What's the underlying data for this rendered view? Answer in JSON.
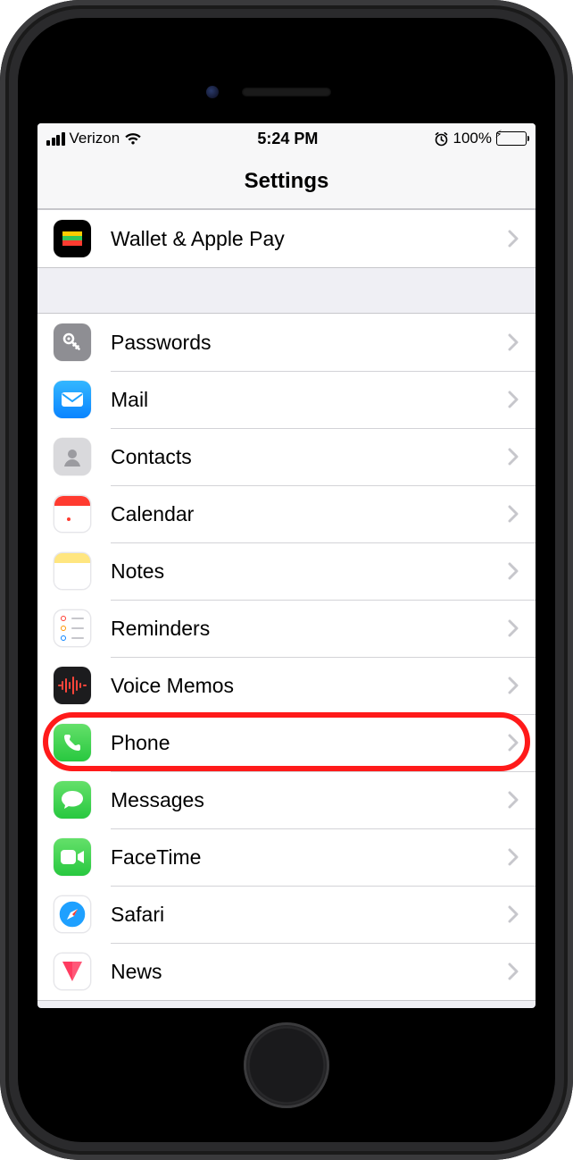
{
  "status_bar": {
    "carrier": "Verizon",
    "time": "5:24 PM",
    "battery_percent": "100%"
  },
  "header": {
    "title": "Settings"
  },
  "sections": [
    {
      "rows": [
        {
          "id": "wallet",
          "label": "Wallet & Apple Pay",
          "icon": "wallet-icon"
        }
      ]
    },
    {
      "rows": [
        {
          "id": "passwords",
          "label": "Passwords",
          "icon": "key-icon"
        },
        {
          "id": "mail",
          "label": "Mail",
          "icon": "mail-icon"
        },
        {
          "id": "contacts",
          "label": "Contacts",
          "icon": "contacts-icon"
        },
        {
          "id": "calendar",
          "label": "Calendar",
          "icon": "calendar-icon"
        },
        {
          "id": "notes",
          "label": "Notes",
          "icon": "notes-icon"
        },
        {
          "id": "reminders",
          "label": "Reminders",
          "icon": "reminders-icon"
        },
        {
          "id": "voice-memos",
          "label": "Voice Memos",
          "icon": "voice-memos-icon"
        },
        {
          "id": "phone",
          "label": "Phone",
          "icon": "phone-icon",
          "highlighted": true
        },
        {
          "id": "messages",
          "label": "Messages",
          "icon": "messages-icon"
        },
        {
          "id": "facetime",
          "label": "FaceTime",
          "icon": "facetime-icon"
        },
        {
          "id": "safari",
          "label": "Safari",
          "icon": "safari-icon"
        },
        {
          "id": "news",
          "label": "News",
          "icon": "news-icon"
        }
      ]
    }
  ]
}
